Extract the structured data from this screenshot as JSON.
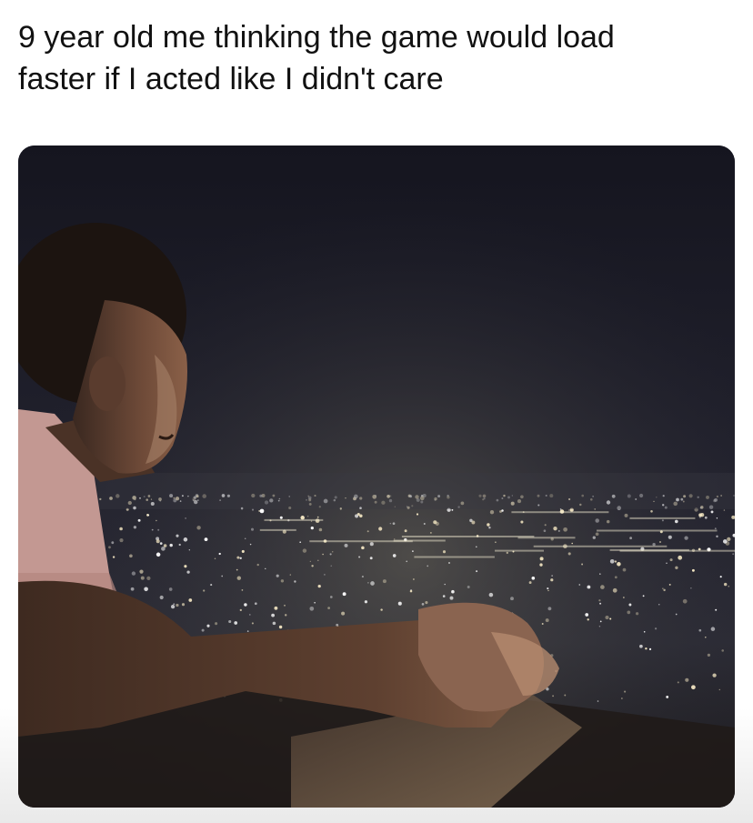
{
  "post": {
    "caption_lines": [
      "9 year old me thinking the game would load",
      "faster if I acted like I didn't care"
    ]
  },
  "photo": {
    "description_icon": "meme-photo",
    "colors": {
      "sky_top": "#1b1b2b",
      "sky_bottom": "#2e2e3a",
      "city_lights": "#f2f0dc",
      "skin": "#6a4836",
      "shirt": "#c79a94"
    }
  }
}
